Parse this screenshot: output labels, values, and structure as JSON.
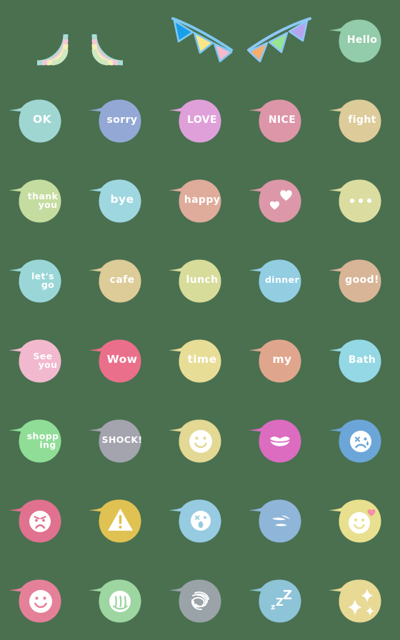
{
  "page": {
    "title": "Speech Bubble Emoji Sticker Set",
    "background_color": "#4a7050",
    "columns": 5,
    "rows": 8,
    "text_color": "#ffffff"
  },
  "stickers": [
    {
      "id": "rainbow-left",
      "kind": "rainbow",
      "variant": "left",
      "label": "rainbow left half",
      "colors": [
        "#a8ddd4",
        "#f4c7da",
        "#f6f0b4",
        "#cfe8c0"
      ]
    },
    {
      "id": "rainbow-right",
      "kind": "rainbow",
      "variant": "right",
      "label": "rainbow right half",
      "colors": [
        "#a8ddd4",
        "#f4c7da",
        "#f6f0b4",
        "#cfe8c0"
      ]
    },
    {
      "id": "bunting-left",
      "kind": "bunting",
      "variant": "down",
      "label": "party bunting descending",
      "string_color": "#7ec8f2",
      "flag_colors": [
        "#189fe8",
        "#fbe78a",
        "#f8b9cd"
      ]
    },
    {
      "id": "bunting-right",
      "kind": "bunting",
      "variant": "up",
      "label": "party bunting ascending",
      "string_color": "#8ec8f5",
      "flag_colors": [
        "#f9ad6c",
        "#96e58f",
        "#b6a4f0"
      ]
    },
    {
      "id": "hello",
      "kind": "bubble-text",
      "text": [
        "Hello"
      ],
      "color": "#93ccaa",
      "size": "lg"
    },
    {
      "id": "ok",
      "kind": "bubble-text",
      "text": [
        "OK"
      ],
      "color": "#9fd6d2",
      "size": "xl"
    },
    {
      "id": "sorry",
      "kind": "bubble-text",
      "text": [
        "sorry"
      ],
      "color": "#93a8d4",
      "size": "lg"
    },
    {
      "id": "love",
      "kind": "bubble-text",
      "text": [
        "LOVE"
      ],
      "color": "#dfa0da",
      "size": "lg"
    },
    {
      "id": "nice",
      "kind": "bubble-text",
      "text": [
        "NICE"
      ],
      "color": "#dd96a8",
      "size": "lg"
    },
    {
      "id": "fight",
      "kind": "bubble-text",
      "text": [
        "fight"
      ],
      "color": "#ddcb9a",
      "size": "lg"
    },
    {
      "id": "thank-you",
      "kind": "bubble-text",
      "text": [
        "thank",
        "you"
      ],
      "color": "#c5dca0",
      "size": "md",
      "stacked": true
    },
    {
      "id": "bye",
      "kind": "bubble-text",
      "text": [
        "bye"
      ],
      "color": "#9ed7e0",
      "size": "xl"
    },
    {
      "id": "happy",
      "kind": "bubble-text",
      "text": [
        "happy"
      ],
      "color": "#dfab9b",
      "size": "lg"
    },
    {
      "id": "hearts",
      "kind": "bubble-icon",
      "icon": "two-hearts-icon",
      "text": [],
      "color": "#dc98a8"
    },
    {
      "id": "dots",
      "kind": "bubble-icon",
      "icon": "ellipsis-dots-icon",
      "text": [],
      "color": "#dbdda0"
    },
    {
      "id": "lets-go",
      "kind": "bubble-text",
      "text": [
        "let's",
        "go"
      ],
      "color": "#9ad6d8",
      "size": "md",
      "stacked": true
    },
    {
      "id": "cafe",
      "kind": "bubble-text",
      "text": [
        "cafe"
      ],
      "color": "#ddcb98",
      "size": "lg"
    },
    {
      "id": "lunch",
      "kind": "bubble-text",
      "text": [
        "lunch"
      ],
      "color": "#d8dc9a",
      "size": "lg"
    },
    {
      "id": "dinner",
      "kind": "bubble-text",
      "text": [
        "dinner"
      ],
      "color": "#92cde2",
      "size": "md"
    },
    {
      "id": "good",
      "kind": "bubble-text",
      "text": [
        "good!"
      ],
      "color": "#d8b596",
      "size": "lg"
    },
    {
      "id": "see-you",
      "kind": "bubble-text",
      "text": [
        "See",
        "you"
      ],
      "color": "#f2b9ce",
      "size": "md",
      "stacked": true
    },
    {
      "id": "wow",
      "kind": "bubble-text",
      "text": [
        "Wow"
      ],
      "color": "#ea6f8b",
      "size": "xl"
    },
    {
      "id": "time",
      "kind": "bubble-text",
      "text": [
        "time"
      ],
      "color": "#e8dd96",
      "size": "xl"
    },
    {
      "id": "my",
      "kind": "bubble-text",
      "text": [
        "my"
      ],
      "color": "#e0a68d",
      "size": "xl"
    },
    {
      "id": "bath",
      "kind": "bubble-text",
      "text": [
        "Bath"
      ],
      "color": "#93d8e4",
      "size": "lg"
    },
    {
      "id": "shopping",
      "kind": "bubble-text",
      "text": [
        "shopp",
        "ing"
      ],
      "color": "#8fdd96",
      "size": "md",
      "stacked": true
    },
    {
      "id": "shock",
      "kind": "bubble-text",
      "text": [
        "SHOCK!"
      ],
      "color": "#a3a4ae",
      "size": "md"
    },
    {
      "id": "smile-yellow",
      "kind": "bubble-icon",
      "icon": "smiley-face-icon",
      "text": [],
      "color": "#e3d894"
    },
    {
      "id": "lips",
      "kind": "bubble-icon",
      "icon": "lips-icon",
      "text": [],
      "color": "#db6cc0"
    },
    {
      "id": "crying",
      "kind": "bubble-icon",
      "icon": "crying-face-icon",
      "text": [],
      "color": "#6ca6d8"
    },
    {
      "id": "angry",
      "kind": "bubble-icon",
      "icon": "angry-face-icon",
      "text": [],
      "color": "#e0718f"
    },
    {
      "id": "warning",
      "kind": "bubble-icon",
      "icon": "warning-triangle-icon",
      "text": [],
      "color": "#dfc251"
    },
    {
      "id": "surprised",
      "kind": "bubble-icon",
      "icon": "surprised-face-icon",
      "text": [],
      "color": "#97cbe2"
    },
    {
      "id": "petals",
      "kind": "bubble-icon",
      "icon": "closed-eyes-icon",
      "text": [],
      "color": "#8fb5d8"
    },
    {
      "id": "smile-heart",
      "kind": "bubble-icon",
      "icon": "smiley-with-heart-icon",
      "text": [],
      "color": "#e8e08e",
      "accent": "#f58fa8"
    },
    {
      "id": "smile-pink",
      "kind": "bubble-icon",
      "icon": "smiley-face-icon",
      "text": [],
      "color": "#e48198"
    },
    {
      "id": "laugh-green",
      "kind": "bubble-icon",
      "icon": "laughing-tears-icon",
      "text": [],
      "color": "#9dd6a0"
    },
    {
      "id": "scribble",
      "kind": "bubble-icon",
      "icon": "scribble-face-icon",
      "text": [],
      "color": "#9aa3a8"
    },
    {
      "id": "sleep",
      "kind": "bubble-icon",
      "icon": "sleeping-zzz-icon",
      "text": [
        "z",
        "Z",
        "Z"
      ],
      "color": "#8ec4d8"
    },
    {
      "id": "sparkle",
      "kind": "bubble-icon",
      "icon": "sparkles-icon",
      "text": [],
      "color": "#e8d994"
    }
  ]
}
